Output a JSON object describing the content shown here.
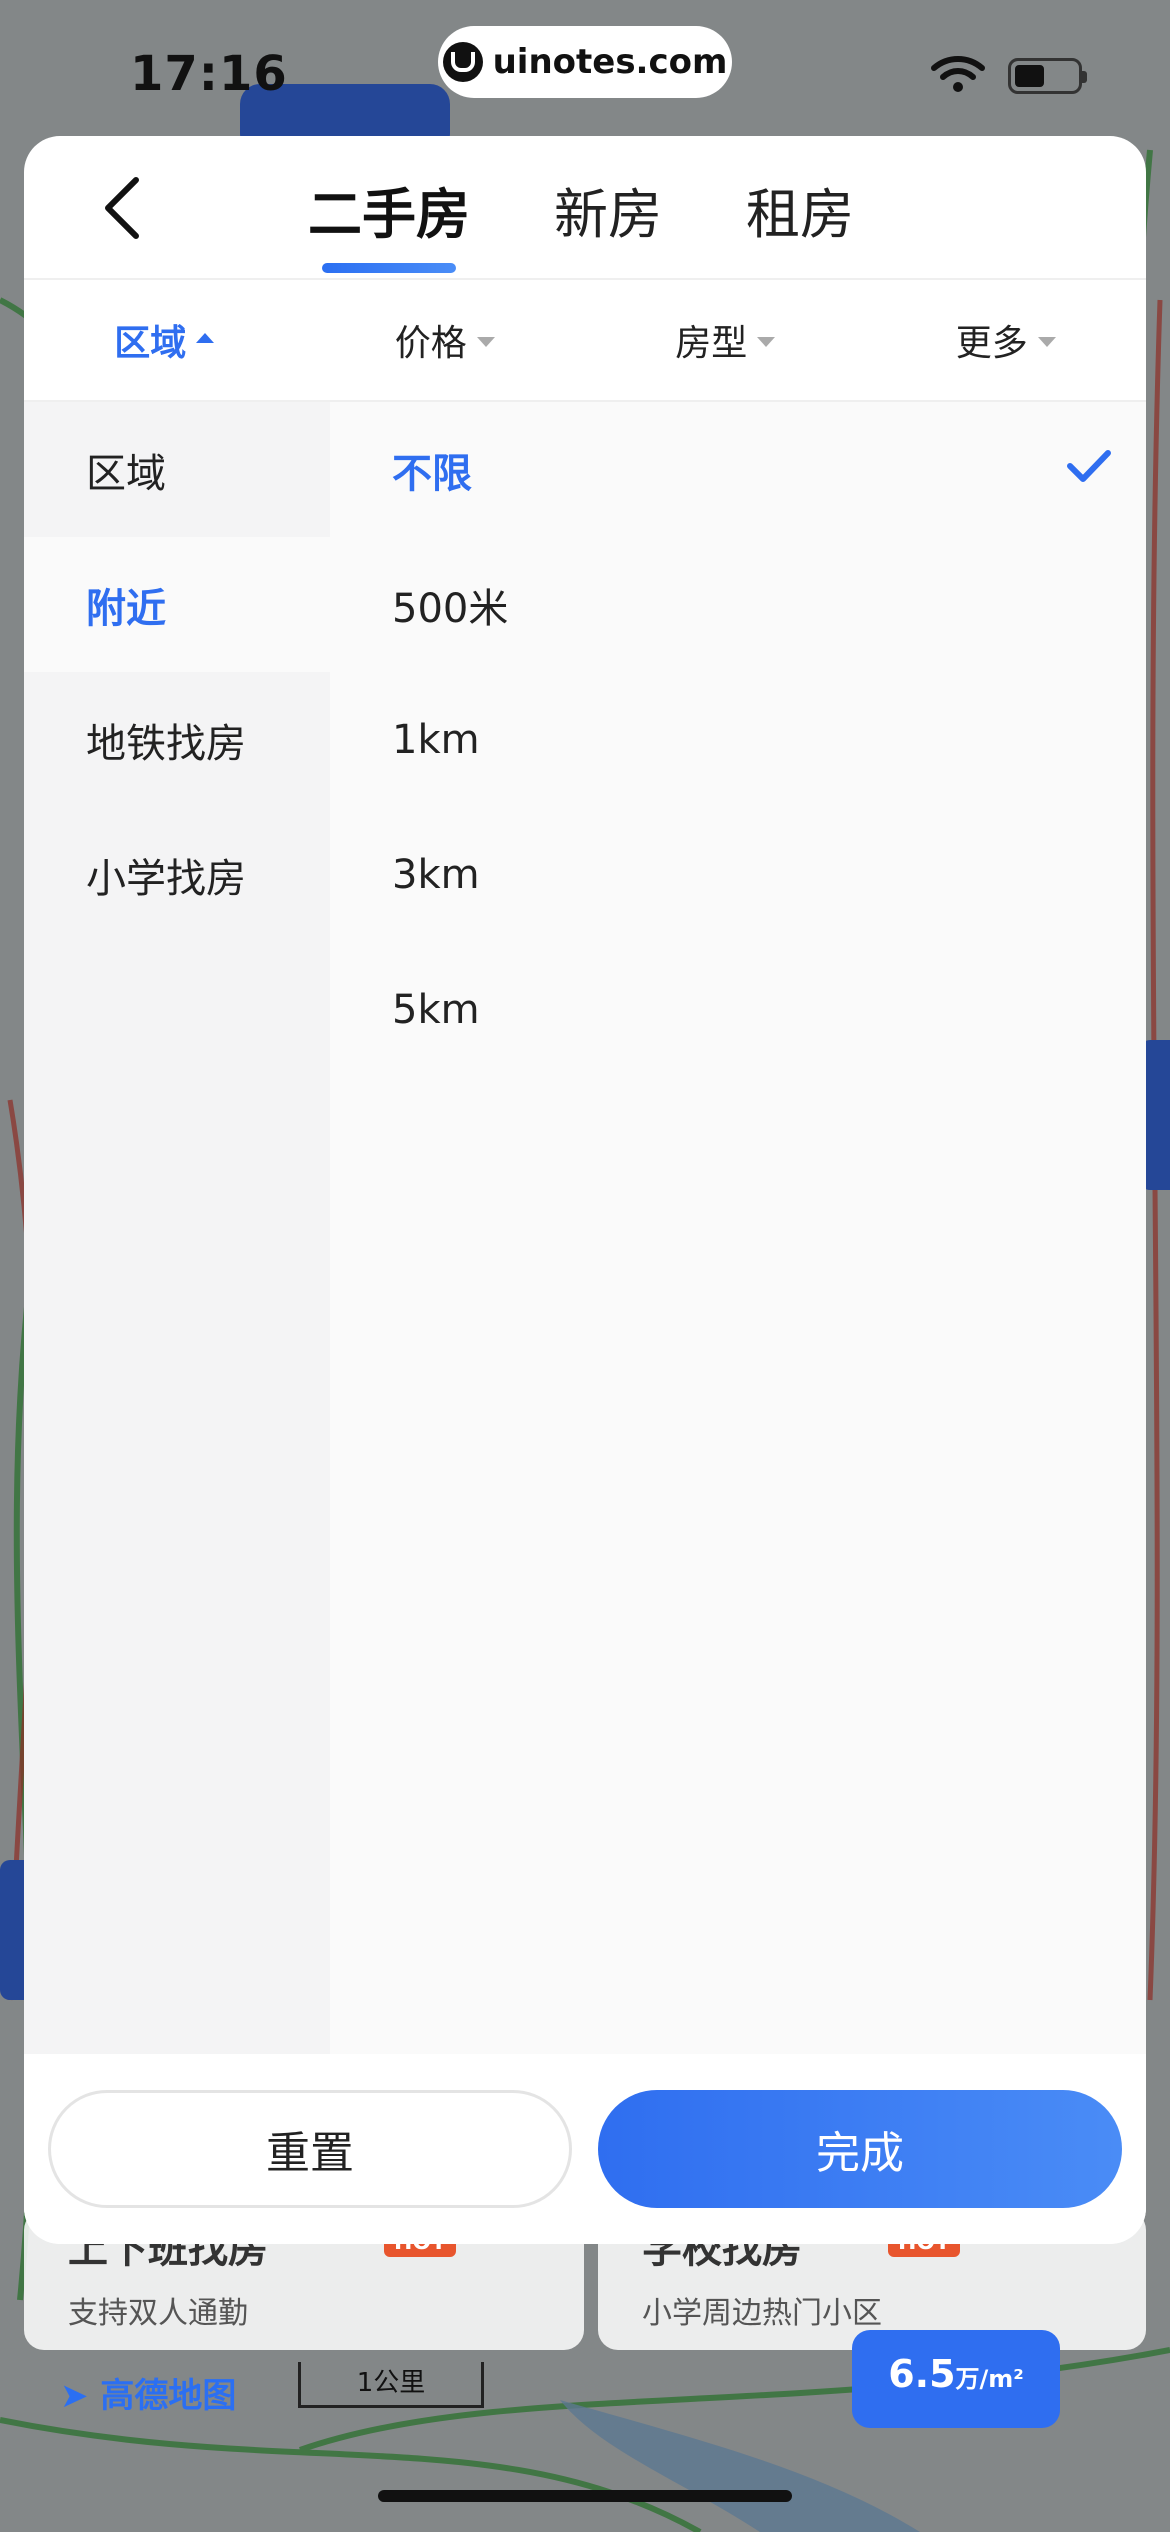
{
  "status_bar": {
    "time": "17:16",
    "url": "uinotes.com"
  },
  "header": {
    "back_icon": "chevron-left-icon",
    "tabs": [
      {
        "label": "二手房",
        "active": true
      },
      {
        "label": "新房",
        "active": false
      },
      {
        "label": "租房",
        "active": false
      }
    ]
  },
  "filters": [
    {
      "label": "区域",
      "active": true
    },
    {
      "label": "价格",
      "active": false
    },
    {
      "label": "房型",
      "active": false
    },
    {
      "label": "更多",
      "active": false
    }
  ],
  "left_menu": [
    {
      "label": "区域",
      "selected": false
    },
    {
      "label": "附近",
      "selected": true
    },
    {
      "label": "地铁找房",
      "selected": false
    },
    {
      "label": "小学找房",
      "selected": false
    }
  ],
  "right_options": [
    {
      "label": "不限",
      "selected": true
    },
    {
      "label": "500米",
      "selected": false
    },
    {
      "label": "1km",
      "selected": false
    },
    {
      "label": "3km",
      "selected": false
    },
    {
      "label": "5km",
      "selected": false
    }
  ],
  "footer": {
    "reset_label": "重置",
    "done_label": "完成"
  },
  "map": {
    "card_left_title": "上下班找房",
    "card_left_sub": "支持双人通勤",
    "card_right_title": "学校找房",
    "card_right_sub": "小学周边热门小区",
    "hot_label": "HOT",
    "logo": "高德地图",
    "scale_label": "1公里",
    "price_value": "6.5",
    "price_unit": "万/m²"
  },
  "colors": {
    "accent": "#2f6ef0",
    "text": "#222222",
    "panel_left": "#f4f4f5",
    "panel_right": "#fafafa"
  }
}
